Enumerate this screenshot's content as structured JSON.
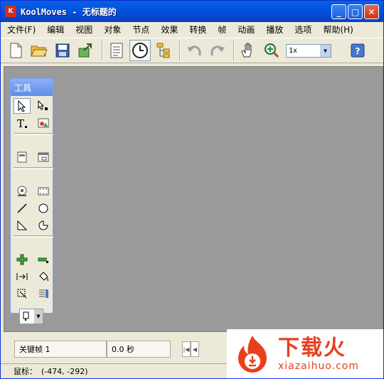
{
  "window": {
    "title": "KoolMoves - 无标题的",
    "app_icon_label": "K",
    "controls": {
      "minimize": "_",
      "maximize": "□",
      "close": "✕"
    }
  },
  "menu": [
    "文件(F)",
    "编辑",
    "视图",
    "对象",
    "节点",
    "效果",
    "转换",
    "帧",
    "动画",
    "播放",
    "选项",
    "帮助(H)"
  ],
  "toolbar": {
    "zoom_value": "1x",
    "icons": [
      "new-file",
      "open-folder",
      "save-disk",
      "export",
      "properties",
      "clock",
      "hierarchy",
      "undo",
      "redo",
      "hand",
      "zoom-in",
      "help"
    ]
  },
  "tools_panel": {
    "title": "工具",
    "tools": [
      "arrow",
      "subselect",
      "text",
      "image",
      "frame-object",
      "frame-window",
      "sound",
      "video",
      "line",
      "ellipse",
      "polygon",
      "shape-curve",
      "add-point",
      "remove-point",
      "move-points",
      "paint-bucket",
      "transform",
      "align"
    ]
  },
  "bottom": {
    "keyframe_label": "关键帧 1",
    "time_label": "0.0 秒"
  },
  "status": {
    "mouse_label": "鼠标：",
    "mouse_coords": "(-474, -292)"
  },
  "watermark": {
    "big": "下载火",
    "small": "xiazaihuo.com"
  }
}
